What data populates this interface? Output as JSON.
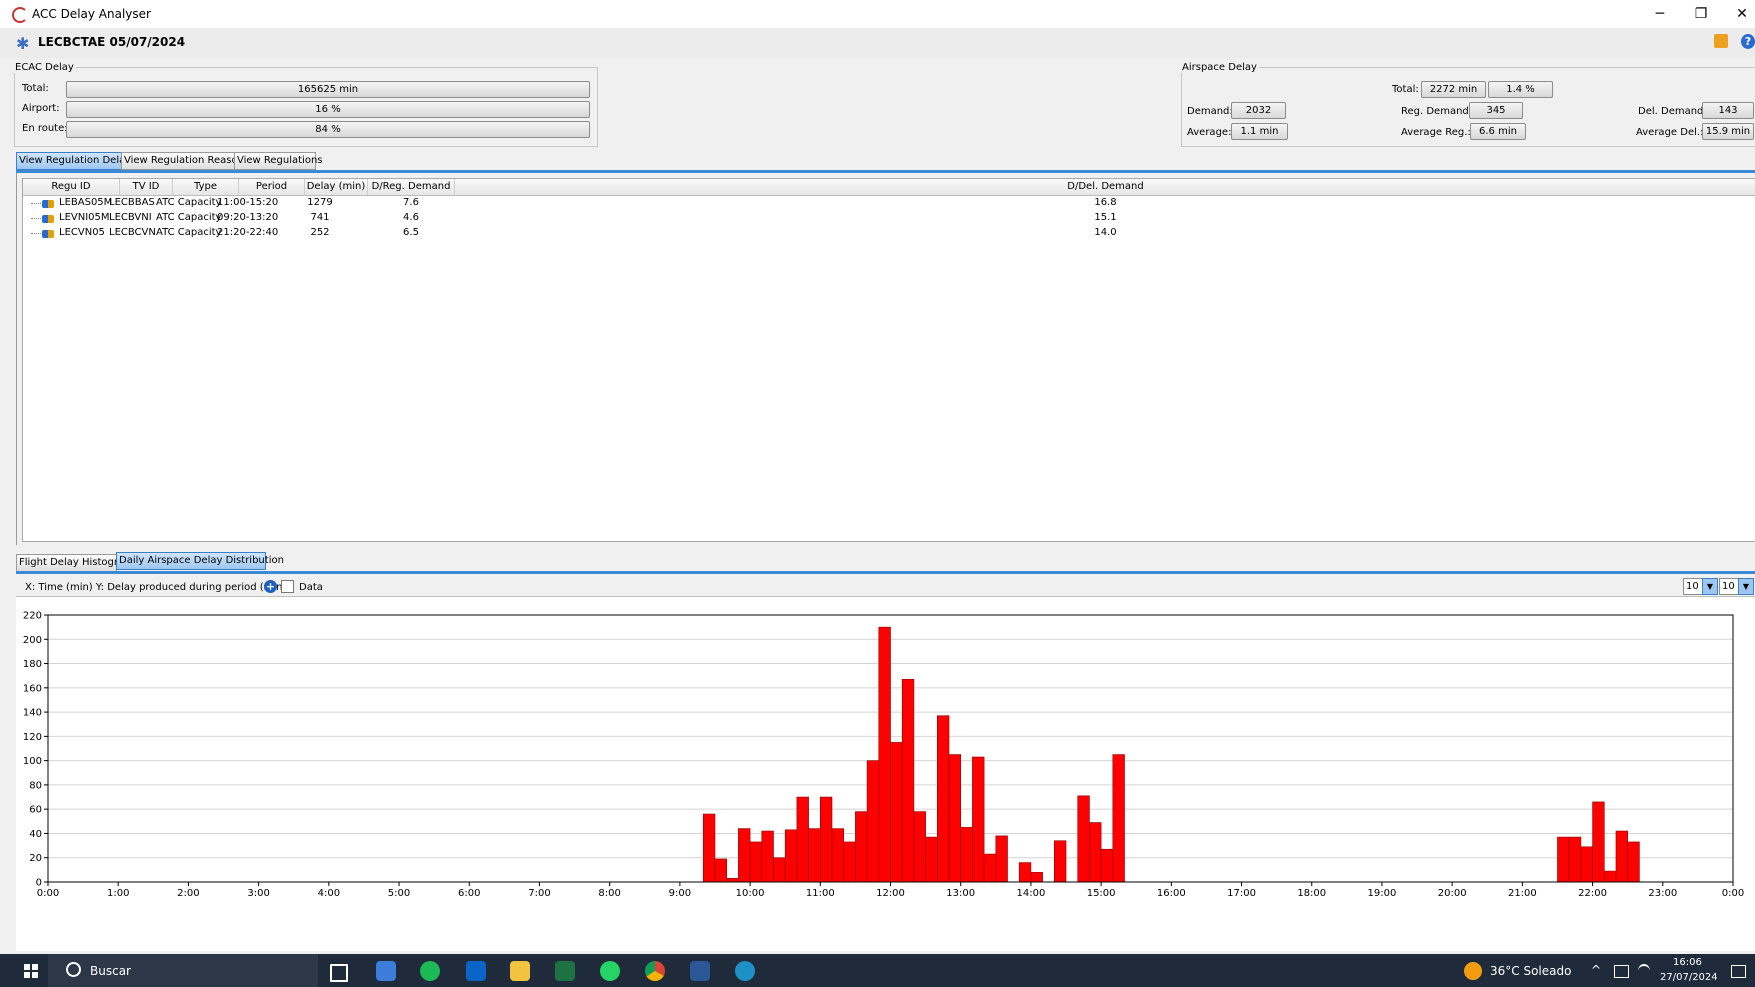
{
  "window": {
    "title": "ACC Delay Analyser",
    "minimize": "─",
    "restore": "❐",
    "close": "✕"
  },
  "header": {
    "title": "LECBCTAE  05/07/2024"
  },
  "ecac": {
    "legend": "ECAC Delay",
    "total_label": "Total:",
    "total_value": "165625 min",
    "airport_label": "Airport:",
    "airport_value": "16 %",
    "airport_pct": 16,
    "enroute_label": "En route:",
    "enroute_value": "84 %",
    "enroute_pct": 84
  },
  "airspace": {
    "legend": "Airspace Delay",
    "total_label": "Total:",
    "total_value": "2272 min",
    "total_pct": "1.4 %",
    "demand_label": "Demand:",
    "demand_value": "2032",
    "reg_demand_label": "Reg. Demand:",
    "reg_demand_value": "345",
    "del_demand_label": "Del. Demand:",
    "del_demand_value": "143",
    "average_label": "Average:",
    "average_value": "1.1 min",
    "average_reg_label": "Average Reg.:",
    "average_reg_value": "6.6 min",
    "average_del_label": "Average Del.:",
    "average_del_value": "15.9 min"
  },
  "top_tabs": [
    "View Regulation Delays",
    "View Regulation Reasons",
    "View Regulations"
  ],
  "table": {
    "columns": [
      "Regu ID",
      "TV ID",
      "Type",
      "Period",
      "Delay (min)",
      "D/Reg. Demand",
      "D/Del. Demand"
    ],
    "rows": [
      [
        "LEBAS05M",
        "LECBBAS",
        "ATC Capacity",
        "11:00-15:20",
        "1279",
        "7.6",
        "16.8"
      ],
      [
        "LEVNI05M",
        "LECBVNI",
        "ATC Capacity",
        "09:20-13:20",
        "741",
        "4.6",
        "15.1"
      ],
      [
        "LECVN05",
        "LECBCVN",
        "ATC Capacity",
        "21:20-22:40",
        "252",
        "6.5",
        "14.0"
      ]
    ]
  },
  "bottom_tabs": [
    "Flight Delay Histogram",
    "Daily Airspace Delay Distribution"
  ],
  "chart_toolbar": {
    "axis_info": "X: Time (min)  Y: Delay produced during period (min)",
    "data_label": "Data",
    "spinner1": "10",
    "spinner2": "10"
  },
  "chart_data": {
    "type": "bar",
    "xlabel": "Time (min)",
    "ylabel": "Delay produced during period (min)",
    "x_ticks": [
      "0:00",
      "1:00",
      "2:00",
      "3:00",
      "4:00",
      "5:00",
      "6:00",
      "7:00",
      "8:00",
      "9:00",
      "10:00",
      "11:00",
      "12:00",
      "13:00",
      "14:00",
      "15:00",
      "16:00",
      "17:00",
      "18:00",
      "19:00",
      "20:00",
      "21:00",
      "22:00",
      "23:00",
      "0:00"
    ],
    "y_ticks": [
      0,
      20,
      40,
      60,
      80,
      100,
      120,
      140,
      160,
      180,
      200,
      220
    ],
    "ylim": [
      0,
      220
    ],
    "xlim_min": [
      0,
      1440
    ],
    "bin_minutes": 10,
    "x": [
      560,
      570,
      580,
      590,
      600,
      610,
      620,
      630,
      640,
      650,
      660,
      670,
      680,
      690,
      700,
      710,
      720,
      730,
      740,
      750,
      760,
      770,
      780,
      790,
      800,
      810,
      820,
      830,
      840,
      850,
      860,
      870,
      880,
      890,
      900,
      910,
      920,
      1290,
      1300,
      1310,
      1320,
      1330,
      1340,
      1350
    ],
    "values": [
      56,
      19,
      3,
      44,
      33,
      42,
      20,
      43,
      70,
      44,
      70,
      44,
      33,
      58,
      100,
      210,
      115,
      167,
      58,
      37,
      137,
      105,
      45,
      103,
      23,
      38,
      0,
      16,
      8,
      0,
      34,
      0,
      71,
      49,
      27,
      105,
      0,
      37,
      37,
      29,
      66,
      9,
      42,
      33
    ],
    "color": "#ff0000",
    "grid": true
  },
  "taskbar": {
    "search": "Buscar",
    "weather": "36°C  Soleado",
    "time": "16:06",
    "date": "27/07/2024"
  }
}
